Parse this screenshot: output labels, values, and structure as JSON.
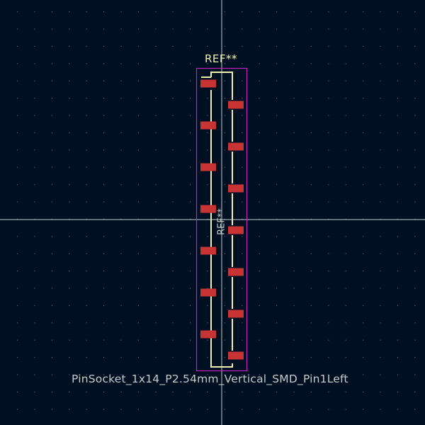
{
  "footprint": {
    "reference": "REF**",
    "fab_reference": "REF**",
    "value": "PinSocket_1x14_P2.54mm_Vertical_SMD_Pin1Left",
    "pad_count": 14,
    "left_pads": 7,
    "right_pads": 7
  },
  "colors": {
    "background": "#001023",
    "grid_dot": "#5a6172",
    "axis": "#c8c8c8",
    "courtyard": "#c020c0",
    "silkscreen": "#f2efb0",
    "pad": "#c83434",
    "reference_text": "#f2efb0",
    "fab_text": "#c8c8c8"
  }
}
